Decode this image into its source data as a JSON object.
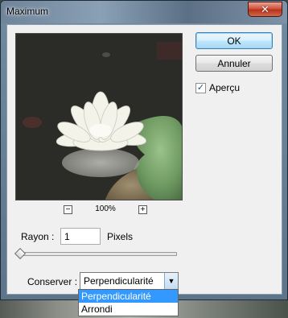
{
  "window": {
    "title": "Maximum"
  },
  "buttons": {
    "ok": "OK",
    "cancel": "Annuler"
  },
  "preview_toggle": {
    "label": "Aperçu",
    "checked": true
  },
  "zoom": {
    "value": "100%",
    "minus": "−",
    "plus": "+"
  },
  "radius": {
    "label": "Rayon :",
    "value": "1",
    "unit": "Pixels",
    "slider_fraction": 0.0
  },
  "preserve": {
    "label": "Conserver :",
    "selected": "Perpendicularité",
    "options": [
      "Perpendicularité",
      "Arrondi"
    ]
  },
  "colors": {
    "accent": "#3399ff",
    "titlebar": "#6f8499",
    "close": "#c7442c"
  }
}
